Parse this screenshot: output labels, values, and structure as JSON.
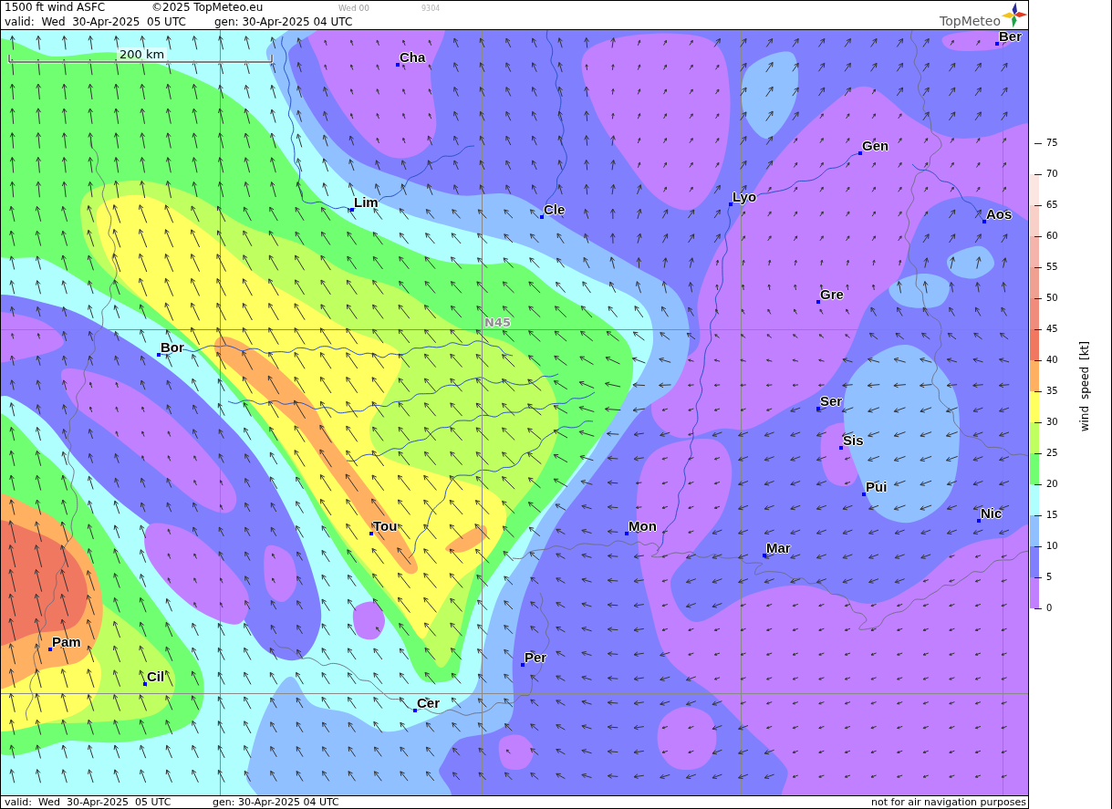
{
  "header": {
    "title": "1500 ft wind ASFC",
    "copyright": "©2025 TopMeteo.eu",
    "run_label": "Wed 00",
    "code": "9304",
    "valid": "valid:  Wed  30-Apr-2025  05 UTC",
    "generated": "gen: 30-Apr-2025 04 UTC"
  },
  "logo": {
    "text": "TopMeteo"
  },
  "map": {
    "scale_label": "200 km",
    "latitude_label": "N45",
    "cities": [
      "Ber",
      "Cha",
      "Gen",
      "Lyo",
      "Lim",
      "Cle",
      "Aos",
      "Gre",
      "Bor",
      "Ser",
      "Sis",
      "Pui",
      "Nic",
      "Tou",
      "Mon",
      "Mar",
      "Pam",
      "Per",
      "Cil",
      "Cer"
    ]
  },
  "legend": {
    "title": "wind speed [kt]",
    "ticks": [
      "75",
      "70",
      "65",
      "60",
      "55",
      "50",
      "45",
      "40",
      "35",
      "30",
      "25",
      "20",
      "15",
      "10",
      "5",
      "0"
    ],
    "bins": [
      {
        "color": "#fce6e2"
      },
      {
        "color": "#f8d0c8"
      },
      {
        "color": "#f4b4ac"
      },
      {
        "color": "#f0a090"
      },
      {
        "color": "#f08c7c"
      },
      {
        "color": "#f07860"
      },
      {
        "color": "#ffb060"
      },
      {
        "color": "#ffff60"
      },
      {
        "color": "#c0ff60"
      },
      {
        "color": "#70ff70"
      },
      {
        "color": "#b0ffff"
      },
      {
        "color": "#90c0ff"
      },
      {
        "color": "#8080ff"
      },
      {
        "color": "#c080ff"
      }
    ]
  },
  "footer": {
    "valid": "valid:  Wed  30-Apr-2025  05 UTC",
    "generated": "gen: 30-Apr-2025 04 UTC",
    "disclaimer": "not for air navigation purposes"
  }
}
